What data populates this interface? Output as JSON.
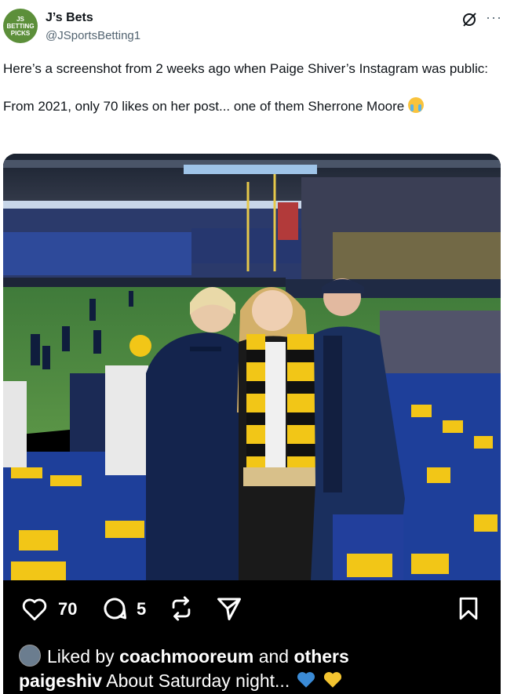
{
  "tweet": {
    "author_name": "J’s Bets",
    "author_handle": "@JSportsBetting1",
    "avatar_text": "JS BETTING PICKS",
    "text": "Here’s a screenshot from 2 weeks ago when Paige Shiver’s Instagram was public:\n\nFrom 2021, only 70 likes on her post... one of them Sherrone Moore",
    "emoji": "loudly-crying-face"
  },
  "instagram": {
    "likes_count": "70",
    "comments_count": "5",
    "liked_by_prefix": "Liked by ",
    "liked_by_user": "coachmooreum",
    "liked_by_and": " and ",
    "liked_by_others": "others",
    "caption_user": "paigeshiv",
    "caption_text": " About Saturday night... ",
    "caption_emojis": [
      "blue-heart",
      "yellow-heart"
    ]
  },
  "icons": {
    "grok": "grok-icon",
    "more": "more-icon",
    "like": "heart-icon",
    "comment": "comment-icon",
    "repost": "repost-icon",
    "share": "share-icon",
    "save": "bookmark-icon"
  },
  "colors": {
    "text": "#0f1419",
    "secondary": "#536471",
    "avatar_green": "#5c8f3a",
    "michigan_blue": "#00274c",
    "maize": "#ffcb05"
  }
}
